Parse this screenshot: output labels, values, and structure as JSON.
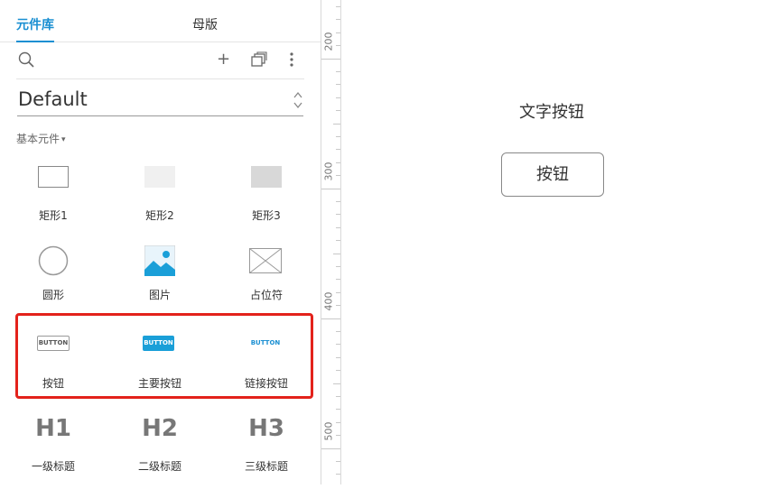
{
  "tabs": [
    {
      "label": "元件库",
      "active": true
    },
    {
      "label": "母版",
      "active": false
    }
  ],
  "toolbar": {
    "icons": [
      "search-icon",
      "plus-icon",
      "pages-icon",
      "more-icon"
    ],
    "plus_glyph": "+"
  },
  "library_select": {
    "value": "Default"
  },
  "category": {
    "label": "基本元件",
    "caret": "▾"
  },
  "widgets": [
    {
      "label": "矩形1"
    },
    {
      "label": "矩形2"
    },
    {
      "label": "矩形3"
    },
    {
      "label": "圆形"
    },
    {
      "label": "图片"
    },
    {
      "label": "占位符"
    },
    {
      "label": "按钮",
      "thumb_text": "BUTTON"
    },
    {
      "label": "主要按钮",
      "thumb_text": "BUTTON"
    },
    {
      "label": "链接按钮",
      "thumb_text": "BUTTON"
    },
    {
      "label": "一级标题",
      "thumb_text": "H1"
    },
    {
      "label": "二级标题",
      "thumb_text": "H2"
    },
    {
      "label": "三级标题",
      "thumb_text": "H3"
    }
  ],
  "ruler": {
    "labels": [
      "200",
      "300",
      "400",
      "500"
    ]
  },
  "canvas": {
    "text_button": "文字按钮",
    "button": "按钮"
  },
  "colors": {
    "accent": "#1a8fd2",
    "highlight": "#e3221b",
    "primary_button": "#1a9fd8"
  }
}
